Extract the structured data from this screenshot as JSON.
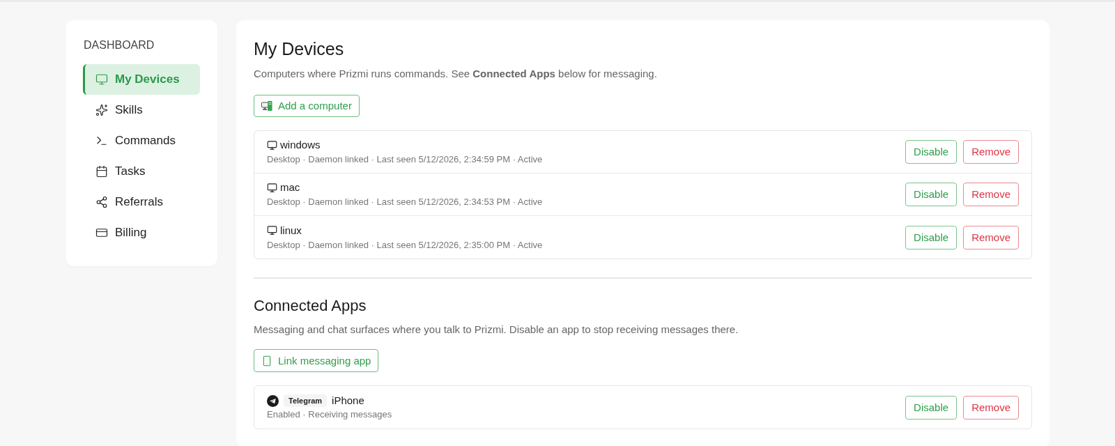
{
  "sidebar": {
    "heading": "DASHBOARD",
    "items": [
      {
        "label": "My Devices",
        "selected": true
      },
      {
        "label": "Skills",
        "selected": false
      },
      {
        "label": "Commands",
        "selected": false
      },
      {
        "label": "Tasks",
        "selected": false
      },
      {
        "label": "Referrals",
        "selected": false
      },
      {
        "label": "Billing",
        "selected": false
      }
    ]
  },
  "devices_section": {
    "title": "My Devices",
    "description": "Computers where Prizmi runs commands. See **Connected Apps** below for messaging.",
    "add_button": "Add a computer",
    "devices": [
      {
        "name": "windows",
        "details": "Desktop · Daemon linked · Last seen 5/12/2026, 2:34:59 PM · Active",
        "actions": [
          {
            "label": "Disable",
            "kind": "outline"
          },
          {
            "label": "Remove",
            "kind": "danger"
          }
        ]
      },
      {
        "name": "mac",
        "details": "Desktop · Daemon linked · Last seen 5/12/2026, 2:34:53 PM · Active",
        "actions": [
          {
            "label": "Disable",
            "kind": "outline"
          },
          {
            "label": "Remove",
            "kind": "danger"
          }
        ]
      },
      {
        "name": "linux",
        "details": "Desktop · Daemon linked · Last seen 5/12/2026, 2:35:00 PM · Active",
        "actions": [
          {
            "label": "Disable",
            "kind": "outline"
          },
          {
            "label": "Remove",
            "kind": "danger"
          }
        ]
      }
    ]
  },
  "apps_section": {
    "title": "Connected Apps",
    "description": "Messaging and chat surfaces where you talk to Prizmi. Disable an app to stop receiving messages there.",
    "add_button": "Link messaging app",
    "apps": [
      {
        "service": "Telegram",
        "name": "iPhone",
        "details": "Enabled · Receiving messages",
        "actions": [
          {
            "label": "Disable",
            "kind": "outline"
          },
          {
            "label": "Remove",
            "kind": "danger"
          }
        ]
      }
    ]
  }
}
